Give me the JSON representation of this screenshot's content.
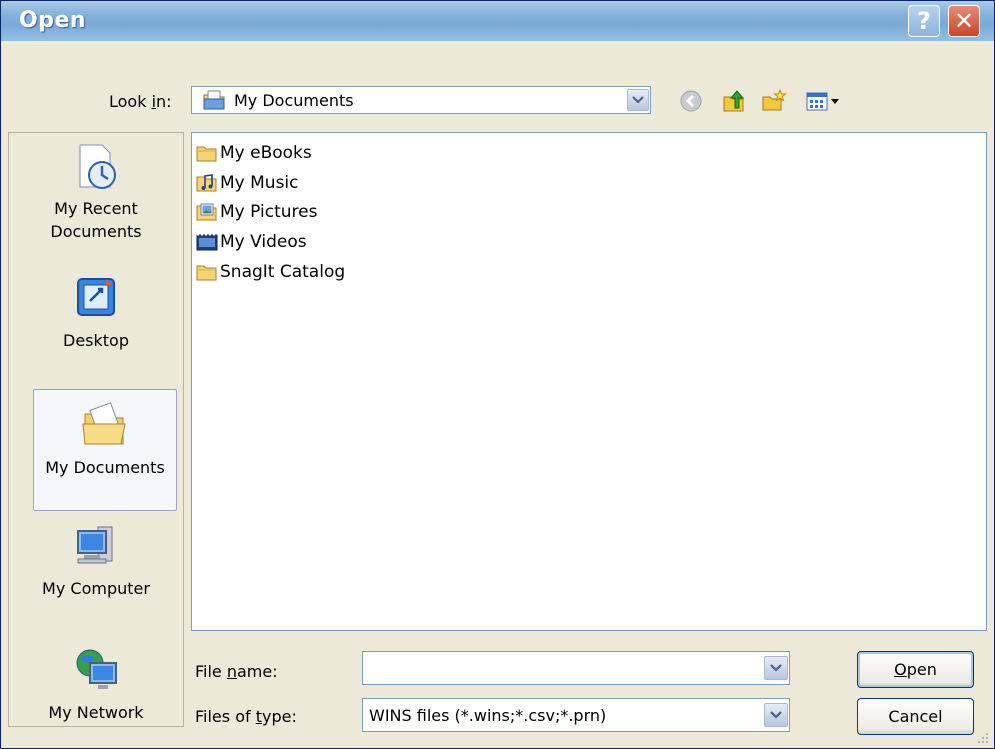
{
  "window": {
    "title": "Open"
  },
  "titlebar": {
    "help_label": "?",
    "close_label": "✕"
  },
  "lookin": {
    "label_prefix": "Look ",
    "label_key": "i",
    "label_suffix": "n:",
    "value": "My Documents",
    "icon": "my-documents-icon"
  },
  "toolbar": {
    "icons": [
      "back-icon",
      "up-folder-icon",
      "new-folder-icon",
      "views-menu-icon"
    ]
  },
  "places": [
    {
      "line1": "My Recent",
      "line2": "Documents",
      "icon": "recent-documents-icon"
    },
    {
      "line1": "Desktop",
      "line2": "",
      "icon": "desktop-icon"
    },
    {
      "line1": "My Documents",
      "line2": "",
      "icon": "my-documents-icon",
      "selected": true
    },
    {
      "line1": "My Computer",
      "line2": "",
      "icon": "my-computer-icon"
    },
    {
      "line1": "My Network",
      "line2": "",
      "icon": "my-network-icon"
    }
  ],
  "files": [
    {
      "name": "My eBooks",
      "icon": "folder-icon"
    },
    {
      "name": "My Music",
      "icon": "music-folder-icon"
    },
    {
      "name": "My Pictures",
      "icon": "pictures-folder-icon"
    },
    {
      "name": "My Videos",
      "icon": "videos-folder-icon"
    },
    {
      "name": "SnagIt Catalog",
      "icon": "folder-icon"
    }
  ],
  "filename": {
    "label_prefix": "File ",
    "label_key": "n",
    "label_suffix": "ame:",
    "value": ""
  },
  "filetype": {
    "label_prefix": "Files of ",
    "label_key": "t",
    "label_suffix": "ype:",
    "value": "WINS files (*.wins;*.csv;*.prn)"
  },
  "buttons": {
    "open_key": "O",
    "open_rest": "pen",
    "cancel": "Cancel"
  },
  "colors": {
    "titlebar": "#83b1d9",
    "face": "#ece9d8",
    "border": "#7f9db9"
  }
}
